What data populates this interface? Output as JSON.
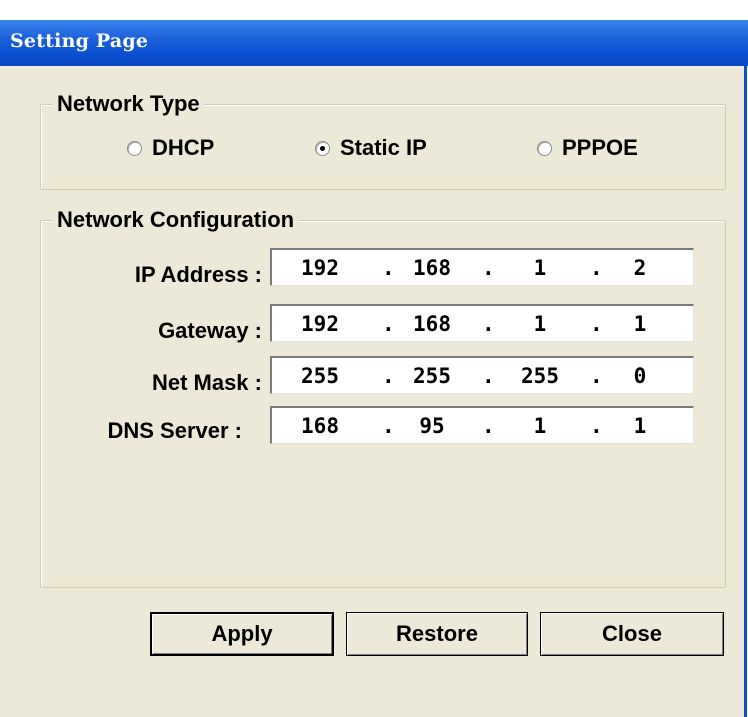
{
  "window": {
    "title": "Setting Page"
  },
  "network_type": {
    "legend": "Network Type",
    "options": [
      {
        "label": "DHCP",
        "checked": false
      },
      {
        "label": "Static IP",
        "checked": true
      },
      {
        "label": "PPPOE",
        "checked": false
      }
    ]
  },
  "network_config": {
    "legend": "Network Configuration",
    "fields": [
      {
        "label": "IP Address :",
        "octets": [
          "192",
          "168",
          "1",
          "2"
        ]
      },
      {
        "label": "Gateway :",
        "octets": [
          "192",
          "168",
          "1",
          "1"
        ]
      },
      {
        "label": "Net Mask :",
        "octets": [
          "255",
          "255",
          "255",
          "0"
        ]
      },
      {
        "label": "DNS Server :",
        "octets": [
          "168",
          "95",
          "1",
          "1"
        ]
      }
    ],
    "separator": "."
  },
  "buttons": {
    "apply": "Apply",
    "restore": "Restore",
    "close": "Close"
  }
}
